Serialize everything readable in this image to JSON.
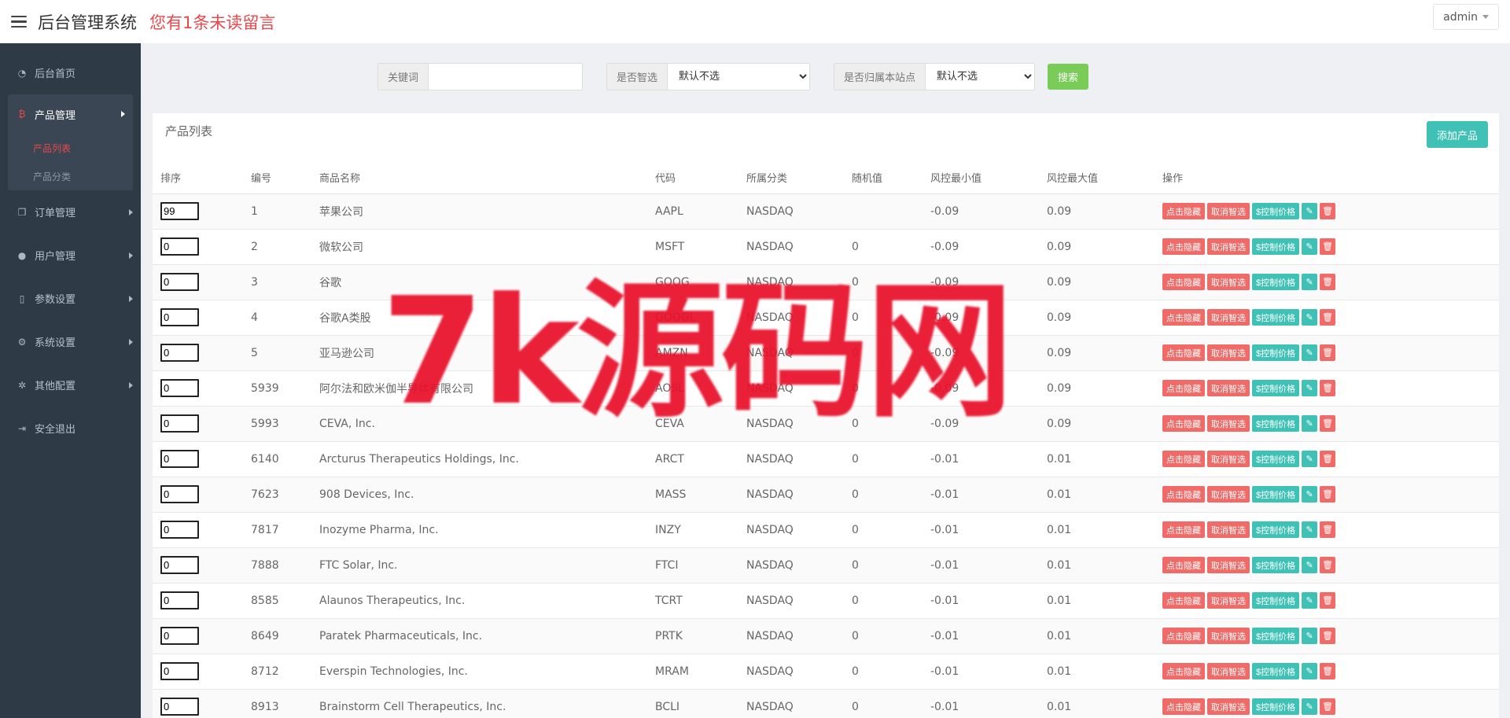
{
  "header": {
    "title": "后台管理系统",
    "unread_notice": "您有1条未读留言",
    "user": "admin"
  },
  "sidebar": {
    "items": [
      {
        "label": "后台首页",
        "icon": "dashboard-icon"
      },
      {
        "label": "产品管理",
        "icon": "bitcoin-icon",
        "expanded": true,
        "children": [
          {
            "label": "产品列表",
            "active": true
          },
          {
            "label": "产品分类",
            "active": false
          }
        ]
      },
      {
        "label": "订单管理",
        "icon": "copy-icon"
      },
      {
        "label": "用户管理",
        "icon": "user-icon"
      },
      {
        "label": "参数设置",
        "icon": "file-icon"
      },
      {
        "label": "系统设置",
        "icon": "cogs-icon"
      },
      {
        "label": "其他配置",
        "icon": "gear-icon"
      },
      {
        "label": "安全退出",
        "icon": "sign-out-icon"
      }
    ]
  },
  "search": {
    "keyword_label": "关键词",
    "keyword_value": "",
    "smart_label": "是否智选",
    "smart_value": "默认不选",
    "site_label": "是否归属本站点",
    "site_value": "默认不选",
    "button_label": "搜索"
  },
  "panel": {
    "title": "产品列表",
    "add_button": "添加产品"
  },
  "table": {
    "columns": [
      "排序",
      "编号",
      "商品名称",
      "代码",
      "所属分类",
      "随机值",
      "风控最小值",
      "风控最大值",
      "操作"
    ],
    "actions": {
      "hide": "点击隐藏",
      "cancel_smart": "取消智选",
      "control_price": "$控制价格",
      "edit_icon": "pencil-icon",
      "delete_icon": "trash-icon"
    },
    "rows": [
      {
        "order": "99",
        "id": "1",
        "name": "苹果公司",
        "code": "AAPL",
        "category": "NASDAQ",
        "random": "",
        "min": "-0.09",
        "max": "0.09"
      },
      {
        "order": "0",
        "id": "2",
        "name": "微软公司",
        "code": "MSFT",
        "category": "NASDAQ",
        "random": "0",
        "min": "-0.09",
        "max": "0.09"
      },
      {
        "order": "0",
        "id": "3",
        "name": "谷歌",
        "code": "GOOG",
        "category": "NASDAQ",
        "random": "0",
        "min": "-0.09",
        "max": "0.09"
      },
      {
        "order": "0",
        "id": "4",
        "name": "谷歌A类股",
        "code": "GOOGL",
        "category": "NASDAQ",
        "random": "0",
        "min": "-0.09",
        "max": "0.09"
      },
      {
        "order": "0",
        "id": "5",
        "name": "亚马逊公司",
        "code": "AMZN",
        "category": "NASDAQ",
        "random": "0",
        "min": "-0.09",
        "max": "0.09"
      },
      {
        "order": "0",
        "id": "5939",
        "name": "阿尔法和欧米伽半导体有限公司",
        "code": "AOSL",
        "category": "NASDAQ",
        "random": "0",
        "min": "-0.09",
        "max": "0.09"
      },
      {
        "order": "0",
        "id": "5993",
        "name": "CEVA, Inc.",
        "code": "CEVA",
        "category": "NASDAQ",
        "random": "0",
        "min": "-0.09",
        "max": "0.09"
      },
      {
        "order": "0",
        "id": "6140",
        "name": "Arcturus Therapeutics Holdings, Inc.",
        "code": "ARCT",
        "category": "NASDAQ",
        "random": "0",
        "min": "-0.01",
        "max": "0.01"
      },
      {
        "order": "0",
        "id": "7623",
        "name": "908 Devices, Inc.",
        "code": "MASS",
        "category": "NASDAQ",
        "random": "0",
        "min": "-0.01",
        "max": "0.01"
      },
      {
        "order": "0",
        "id": "7817",
        "name": "Inozyme Pharma, Inc.",
        "code": "INZY",
        "category": "NASDAQ",
        "random": "0",
        "min": "-0.01",
        "max": "0.01"
      },
      {
        "order": "0",
        "id": "7888",
        "name": "FTC Solar, Inc.",
        "code": "FTCI",
        "category": "NASDAQ",
        "random": "0",
        "min": "-0.01",
        "max": "0.01"
      },
      {
        "order": "0",
        "id": "8585",
        "name": "Alaunos Therapeutics, Inc.",
        "code": "TCRT",
        "category": "NASDAQ",
        "random": "0",
        "min": "-0.01",
        "max": "0.01"
      },
      {
        "order": "0",
        "id": "8649",
        "name": "Paratek Pharmaceuticals, Inc.",
        "code": "PRTK",
        "category": "NASDAQ",
        "random": "0",
        "min": "-0.01",
        "max": "0.01"
      },
      {
        "order": "0",
        "id": "8712",
        "name": "Everspin Technologies, Inc.",
        "code": "MRAM",
        "category": "NASDAQ",
        "random": "0",
        "min": "-0.01",
        "max": "0.01"
      },
      {
        "order": "0",
        "id": "8913",
        "name": "Brainstorm Cell Therapeutics, Inc.",
        "code": "BCLI",
        "category": "NASDAQ",
        "random": "0",
        "min": "-0.01",
        "max": "0.01"
      }
    ]
  },
  "watermark": {
    "text": "7k源码网",
    "color": "#e8102a"
  }
}
